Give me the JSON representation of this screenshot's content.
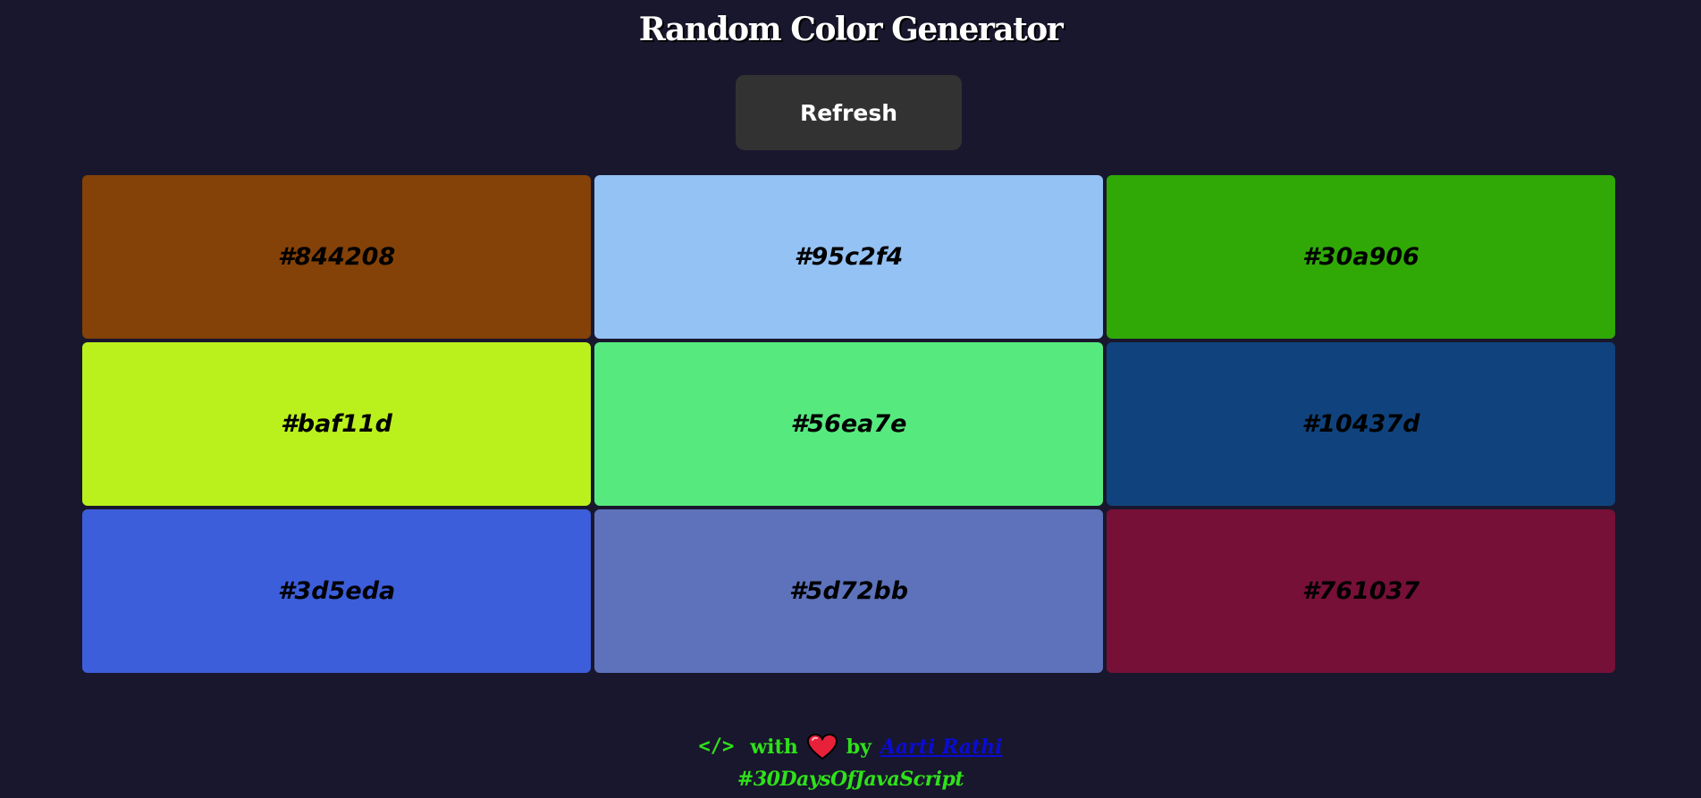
{
  "header": {
    "title": "Random Color Generator",
    "refresh_label": "Refresh"
  },
  "colors": [
    {
      "code": "#844208",
      "hex": "#844208"
    },
    {
      "code": "#95c2f4",
      "hex": "#95c2f4"
    },
    {
      "code": "#30a906",
      "hex": "#30a906"
    },
    {
      "code": "#baf11d",
      "hex": "#baf11d"
    },
    {
      "code": "#56ea7e",
      "hex": "#56ea7e"
    },
    {
      "code": "#10437d",
      "hex": "#10437d"
    },
    {
      "code": "#3d5eda",
      "hex": "#3d5eda"
    },
    {
      "code": "#5d72bb",
      "hex": "#5d72bb"
    },
    {
      "code": "#761037",
      "hex": "#761037"
    }
  ],
  "footer": {
    "code_symbol": "</>",
    "with_text": "with",
    "by_text": "by",
    "author": "Aarti Rathi",
    "hashtag": "#30DaysOfJavaScript",
    "code_icon": "code-icon",
    "heart_icon": "heart-icon"
  },
  "theme": {
    "background": "#19172d",
    "button_bg": "#323232",
    "footer_text": "#2fe11b",
    "link": "#0b0bd6"
  }
}
